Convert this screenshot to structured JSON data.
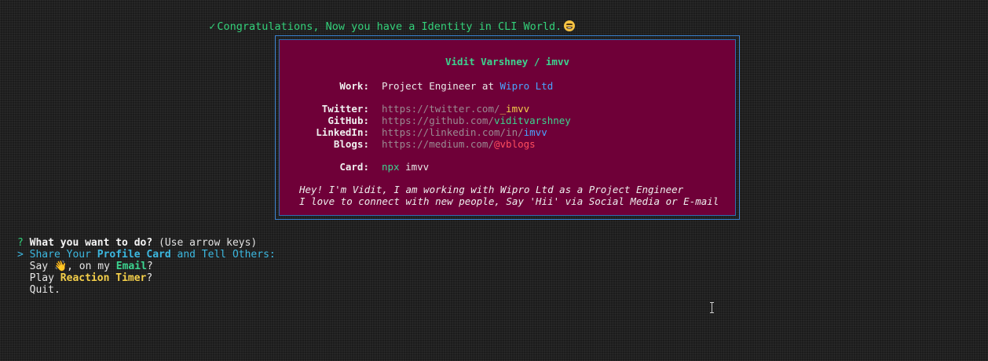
{
  "banner": {
    "check": "✓",
    "text": "Congratulations, Now you have a Identity in CLI World.",
    "emoji_icon": "grinning-face-icon"
  },
  "card": {
    "name": "Vidit Varshney / imvv",
    "work": {
      "label": "Work:",
      "text": "Project Engineer at ",
      "company": "Wipro Ltd"
    },
    "twitter": {
      "label": "Twitter:",
      "base": "https://twitter.com/",
      "handle": "_imvv"
    },
    "github": {
      "label": "GitHub:",
      "base": "https://github.com/",
      "handle": "viditvarshney"
    },
    "linkedin": {
      "label": "LinkedIn:",
      "base": "https://linkedin.com/in/",
      "handle": "imvv"
    },
    "blogs": {
      "label": "Blogs:",
      "base": "https://medium.com/",
      "handle": "@vblogs"
    },
    "card_cmd": {
      "label": "Card:",
      "npx": "npx",
      "pkg": " imvv"
    },
    "bio": [
      "Hey! I'm Vidit, I am working with Wipro Ltd as a Project Engineer",
      "I love to connect with new people, Say 'Hii' via Social Media or E-mail"
    ],
    "colors": {
      "background": "#6f0038",
      "border": "#3b83d1"
    }
  },
  "prompt": {
    "qmark": "?",
    "question": "What you want to do?",
    "hint": " (Use arrow keys)",
    "pointer": ">",
    "options": [
      {
        "pre": "Share Your ",
        "hl": "Profile Card",
        "post": " and Tell Others:"
      },
      {
        "pre": "Say ",
        "icon": "waving-hand-icon",
        "mid": ", on my ",
        "hl": "Email",
        "post": "?"
      },
      {
        "pre": "Play ",
        "hl": "Reaction Timer",
        "post": "?"
      },
      {
        "pre": "Quit.",
        "hl": "",
        "post": ""
      }
    ]
  }
}
